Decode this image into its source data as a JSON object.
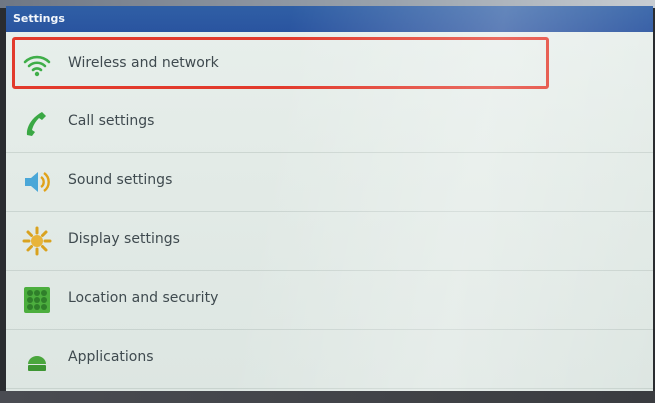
{
  "window": {
    "title": "Settings"
  },
  "menu": {
    "items": [
      {
        "label": "Wireless and network",
        "icon": "wifi-icon",
        "highlighted": true
      },
      {
        "label": "Call settings",
        "icon": "phone-icon"
      },
      {
        "label": "Sound settings",
        "icon": "speaker-icon"
      },
      {
        "label": "Display settings",
        "icon": "brightness-icon"
      },
      {
        "label": "Location and security",
        "icon": "grid-lock-icon"
      },
      {
        "label": "Applications",
        "icon": "android-icon"
      }
    ]
  },
  "colors": {
    "titlebar": "#2c58a2",
    "highlight_border": "#e23a2c",
    "icon_green": "#3fae49"
  }
}
